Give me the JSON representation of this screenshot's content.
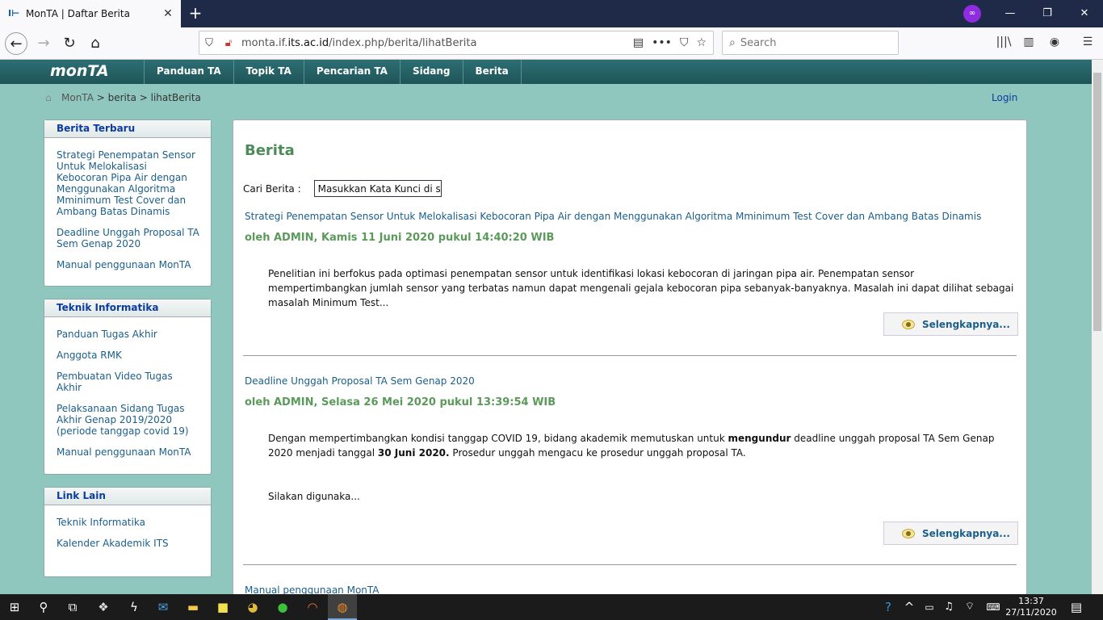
{
  "browser": {
    "tab_title": "MonTA | Daftar Berita",
    "url_prefix": "monta.if.",
    "url_host": "its.ac.id",
    "url_path": "/index.php/berita/lihatBerita",
    "search_placeholder": "Search"
  },
  "site": {
    "logo": "monTA",
    "menu": [
      "Panduan TA",
      "Topik TA",
      "Pencarian TA",
      "Sidang",
      "Berita"
    ],
    "breadcrumb": [
      "MonTA",
      "berita",
      "lihatBerita"
    ],
    "login": "Login"
  },
  "sidebar": {
    "boxes": [
      {
        "title": "Berita Terbaru",
        "items": [
          "Strategi Penempatan Sensor Untuk Melokalisasi Kebocoran Pipa Air dengan Menggunakan Algoritma Mminimum Test Cover dan Ambang Batas Dinamis",
          "Deadline Unggah Proposal TA Sem Genap 2020",
          "Manual penggunaan MonTA"
        ]
      },
      {
        "title": "Teknik Informatika",
        "items": [
          "Panduan Tugas Akhir",
          "Anggota RMK",
          "Pembuatan Video Tugas Akhir",
          "Pelaksanaan Sidang Tugas Akhir Genap 2019/2020 (periode tanggap covid 19)",
          "Manual penggunaan MonTA"
        ]
      },
      {
        "title": "Link Lain",
        "items": [
          "Teknik Informatika",
          "Kalender Akademik ITS"
        ]
      }
    ]
  },
  "main": {
    "heading": "Berita",
    "search_label": "Cari Berita :",
    "search_value": "Masukkan Kata Kunci di sir",
    "more_label": "Selengkapnya...",
    "articles": [
      {
        "title": "Strategi Penempatan Sensor Untuk Melokalisasi Kebocoran Pipa Air dengan Menggunakan Algoritma Mminimum Test Cover dan Ambang Batas Dinamis",
        "meta": "oleh ADMIN, Kamis 11 Juni 2020 pukul 14:40:20 WIB",
        "body": "Penelitian ini berfokus pada optimasi penempatan sensor untuk identifikasi lokasi kebocoran di jaringan pipa air. Penempatan sensor mempertimbangkan jumlah sensor yang terbatas namun dapat mengenali gejala kebocoran pipa sebanyak-banyaknya. Masalah ini dapat dilihat sebagai masalah Minimum Test..."
      },
      {
        "title": "Deadline Unggah Proposal TA Sem Genap 2020",
        "meta": "oleh ADMIN, Selasa 26 Mei 2020 pukul 13:39:54 WIB",
        "body_a": "Dengan mempertimbangkan kondisi tanggap COVID 19, bidang akademik memutuskan untuk",
        "body_b": "mengundur",
        "body_c": "deadline unggah proposal TA Sem Genap 2020 menjadi tanggal",
        "body_d": "30 Juni 2020.",
        "body_e": "Prosedur unggah mengacu ke prosedur unggah proposal TA.",
        "body_f": "Silakan digunaka..."
      },
      {
        "title": "Manual penggunaan MonTA"
      }
    ]
  },
  "taskbar": {
    "time": "13:37",
    "date": "27/11/2020"
  }
}
